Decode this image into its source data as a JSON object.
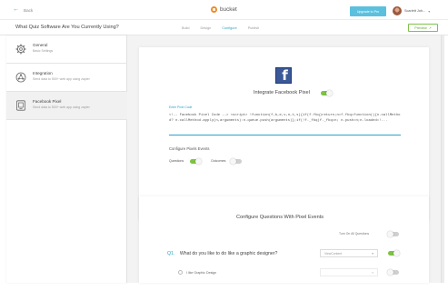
{
  "header": {
    "back_label": "Back",
    "brand": "bucket",
    "upgrade_label": "Upgrade to Pro",
    "user_name": "Scarlett Joh..."
  },
  "subheader": {
    "quiz_title": "What Quiz Software Are You Currently Using?",
    "tabs": [
      {
        "label": "Build",
        "active": false
      },
      {
        "label": "Design",
        "active": false
      },
      {
        "label": "Configure",
        "active": true
      },
      {
        "label": "Publish",
        "active": false
      }
    ],
    "preview_label": "Preview"
  },
  "sidebar": {
    "items": [
      {
        "title": "General",
        "subtitle": "Basic Settings",
        "icon": "gear-icon",
        "active": false
      },
      {
        "title": "Integration",
        "subtitle": "Send data to 500+ web app using zapier",
        "icon": "integration-icon",
        "active": false
      },
      {
        "title": "Facebook Pixel",
        "subtitle": "Send data to 500+ web app using zapier",
        "icon": "pixel-icon",
        "active": true
      }
    ]
  },
  "pixel_card": {
    "integrate_label": "Integrate Facebook Pixel",
    "integrate_on": true,
    "code_label": "Enter Pixel Code",
    "code_value": "<!-- Facebook Pixel Code --> <script> !function(f,b,e,v,n,t,s){if(f.fbq)return;n=f.fbq=function(){n.callMethod? n.callMethod.apply(n,arguments):n.queue.push(arguments)};if(!f._fbq)f._fbq=n; n.push=n;n.loaded=!...",
    "configure_label": "Configure Pixels Events",
    "events": [
      {
        "label": "Questions",
        "on": true
      },
      {
        "label": "Outcomes",
        "on": false
      }
    ]
  },
  "questions_card": {
    "title": "Configure Questions With Pixel Events",
    "turn_on_all_label": "Turn On All Questions",
    "turn_on_all_on": false,
    "question": {
      "number": "Q1.",
      "text": "What do you like to do like a graphic designer?",
      "select_value": "ViewContent",
      "on": true
    },
    "answer": {
      "text": "I like Graphic Design",
      "select_value": "",
      "on": false
    }
  },
  "colors": {
    "accent": "#2aa3c7",
    "toggle_on": "#7dc243",
    "facebook": "#3b5998",
    "brand": "#f08a24"
  }
}
